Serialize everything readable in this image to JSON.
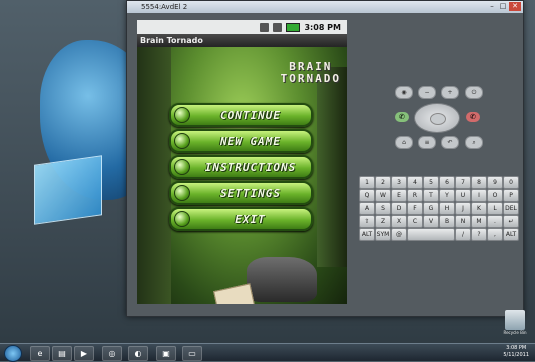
{
  "window": {
    "title": "5554:AvdEl 2"
  },
  "status_bar": {
    "time": "3:08 PM"
  },
  "app": {
    "title": "Brain Tornado"
  },
  "logo": {
    "line1": "BRAIN",
    "line2": "TORNADO"
  },
  "menu": [
    {
      "label": "CONTINUE"
    },
    {
      "label": "NEW GAME"
    },
    {
      "label": "INSTRUCTIONS"
    },
    {
      "label": "SETTINGS"
    },
    {
      "label": "EXIT"
    }
  ],
  "keyboard": {
    "row1": [
      "1",
      "2",
      "3",
      "4",
      "5",
      "6",
      "7",
      "8",
      "9",
      "0"
    ],
    "row2": [
      "Q",
      "W",
      "E",
      "R",
      "T",
      "Y",
      "U",
      "I",
      "O",
      "P"
    ],
    "row3": [
      "A",
      "S",
      "D",
      "F",
      "G",
      "H",
      "J",
      "K",
      "L",
      "DEL"
    ],
    "row4": [
      "⇧",
      "Z",
      "X",
      "C",
      "V",
      "B",
      "N",
      "M",
      ".",
      "↵"
    ],
    "row5": [
      "ALT",
      "SYM",
      "@",
      "",
      "/",
      "?",
      ",",
      "ALT"
    ]
  },
  "taskbar": {
    "time": "3:08 PM",
    "date": "5/11/2011",
    "recycle_label": "Recycle Bin"
  }
}
